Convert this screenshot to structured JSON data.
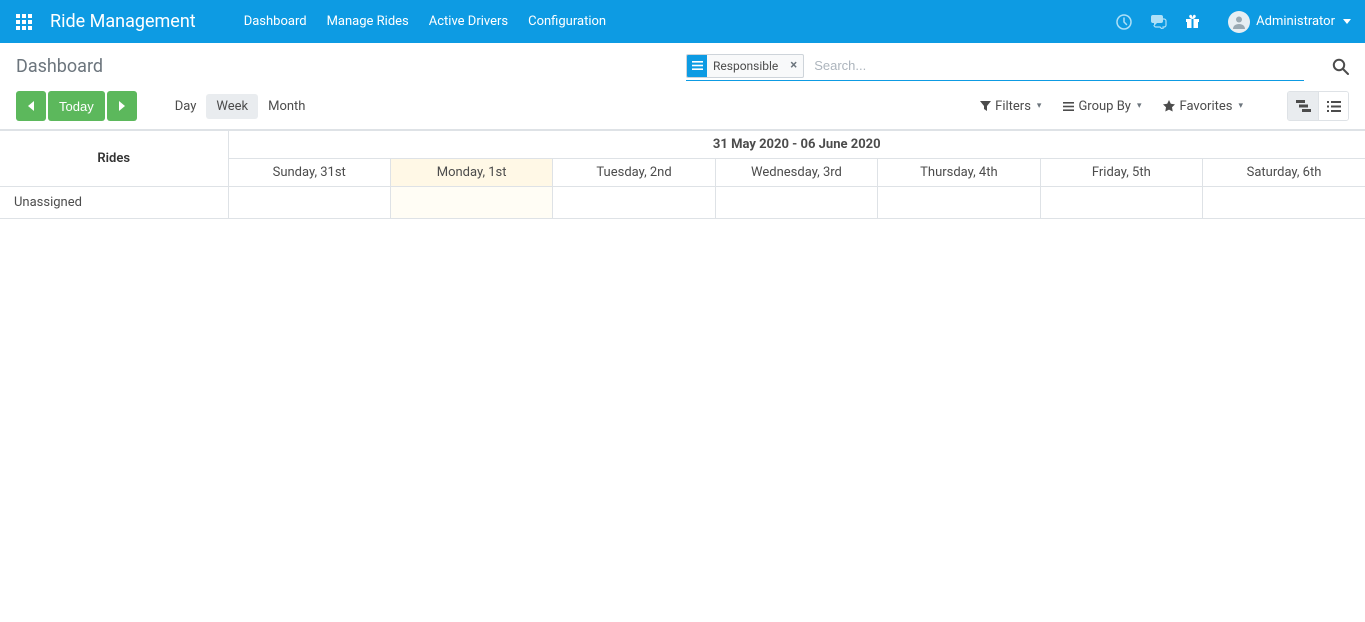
{
  "navbar": {
    "app_title": "Ride Management",
    "menu": [
      "Dashboard",
      "Manage Rides",
      "Active Drivers",
      "Configuration"
    ],
    "user_name": "Administrator"
  },
  "breadcrumb": "Dashboard",
  "search": {
    "facet_label": "Responsible",
    "placeholder": "Search..."
  },
  "controls": {
    "today_label": "Today",
    "scales": [
      "Day",
      "Week",
      "Month"
    ],
    "active_scale": "Week",
    "filters_label": "Filters",
    "groupby_label": "Group By",
    "favorites_label": "Favorites"
  },
  "gantt": {
    "side_header": "Rides",
    "date_range": "31 May 2020 - 06 June 2020",
    "days": [
      {
        "label": "Sunday, 31st",
        "today": false
      },
      {
        "label": "Monday, 1st",
        "today": true
      },
      {
        "label": "Tuesday, 2nd",
        "today": false
      },
      {
        "label": "Wednesday, 3rd",
        "today": false
      },
      {
        "label": "Thursday, 4th",
        "today": false
      },
      {
        "label": "Friday, 5th",
        "today": false
      },
      {
        "label": "Saturday, 6th",
        "today": false
      }
    ],
    "rows": [
      {
        "label": "Unassigned"
      }
    ]
  }
}
